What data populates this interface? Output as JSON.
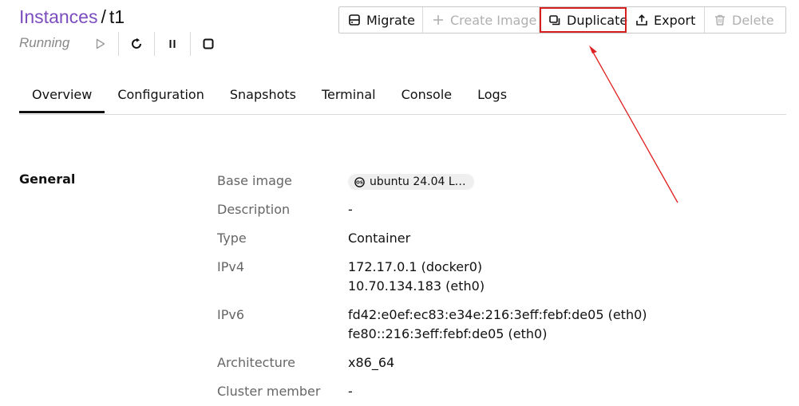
{
  "breadcrumb": {
    "parent": "Instances",
    "separator": "/",
    "current": "t1"
  },
  "status": "Running",
  "controls": [
    {
      "icon": "play-icon",
      "enabled": false
    },
    {
      "icon": "restart-icon",
      "enabled": true
    },
    {
      "icon": "pause-icon",
      "enabled": true
    },
    {
      "icon": "stop-icon",
      "enabled": true
    }
  ],
  "toolbar": {
    "migrate_label": "Migrate",
    "create_image_label": "Create Image",
    "duplicate_label": "Duplicate",
    "export_label": "Export",
    "delete_label": "Delete"
  },
  "tabs": [
    "Overview",
    "Configuration",
    "Snapshots",
    "Terminal",
    "Console",
    "Logs"
  ],
  "active_tab": "Overview",
  "general": {
    "title": "General",
    "base_image_label": "Base image",
    "base_image_value": "ubuntu 24.04 L…",
    "description_label": "Description",
    "description_value": "-",
    "type_label": "Type",
    "type_value": "Container",
    "ipv4_label": "IPv4",
    "ipv4_values": [
      "172.17.0.1 (docker0)",
      "10.70.134.183 (eth0)"
    ],
    "ipv6_label": "IPv6",
    "ipv6_values": [
      "fd42:e0ef:ec83:e34e:216:3eff:febf:de05 (eth0)",
      "fe80::216:3eff:febf:de05 (eth0)"
    ],
    "architecture_label": "Architecture",
    "architecture_value": "x86_64",
    "cluster_member_label": "Cluster member",
    "cluster_member_value": "-"
  },
  "colors": {
    "link": "#7c4dbf",
    "highlight": "#d62020",
    "muted": "#666666",
    "disabled": "#b0b0b0"
  }
}
